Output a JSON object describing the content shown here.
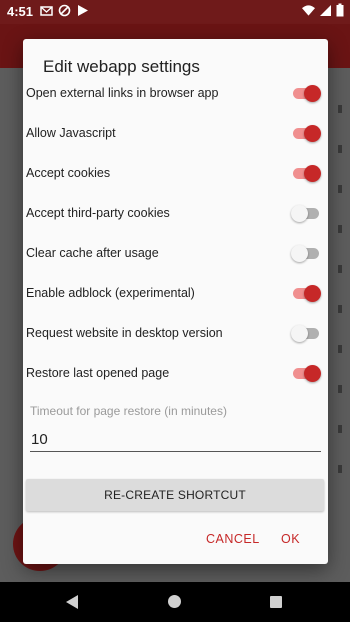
{
  "status_bar": {
    "time": "4:51",
    "icons_left": [
      "mail-icon",
      "block-icon",
      "play-store-icon"
    ],
    "icons_right": [
      "wifi-icon",
      "signal-icon",
      "battery-icon"
    ]
  },
  "dialog": {
    "title": "Edit webapp settings",
    "settings": [
      {
        "label": "Open external links in browser app",
        "enabled": true
      },
      {
        "label": "Allow Javascript",
        "enabled": true
      },
      {
        "label": "Accept cookies",
        "enabled": true
      },
      {
        "label": "Accept third-party cookies",
        "enabled": false
      },
      {
        "label": "Clear cache after usage",
        "enabled": false
      },
      {
        "label": "Enable adblock (experimental)",
        "enabled": true
      },
      {
        "label": "Request website in desktop version",
        "enabled": false
      },
      {
        "label": "Restore last opened page",
        "enabled": true
      }
    ],
    "timeout_label": "Timeout for page restore (in minutes)",
    "timeout_value": "10",
    "recreate_button": "RE-CREATE SHORTCUT",
    "cancel_button": "CANCEL",
    "ok_button": "OK"
  },
  "colors": {
    "accent": "#c62828",
    "accent_track": "#f08f8f",
    "primary_dark": "#6f1a1a"
  }
}
